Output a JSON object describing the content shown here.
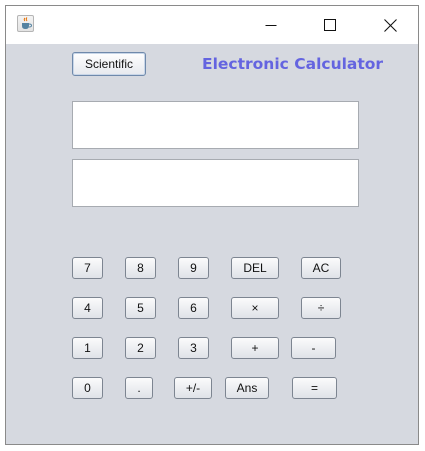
{
  "window": {
    "minimize_glyph": "—",
    "maximize_glyph": "☐",
    "close_glyph": "✕"
  },
  "toolbar": {
    "scientific_label": "Scientific",
    "app_title": "Electronic Calculator"
  },
  "display": {
    "input_value": "",
    "output_value": ""
  },
  "keys": {
    "row1": [
      "7",
      "8",
      "9",
      "DEL",
      "AC"
    ],
    "row2": [
      "4",
      "5",
      "6",
      "×",
      "÷"
    ],
    "row3": [
      "1",
      "2",
      "3",
      "+",
      "-"
    ],
    "row4": [
      "0",
      ".",
      "+/-",
      "Ans",
      "="
    ]
  },
  "colors": {
    "background": "#d6d9e0",
    "title_accent": "#6464e0",
    "titlebar": "#ffffff"
  },
  "icons": {
    "app_icon": "java-cup-icon"
  }
}
